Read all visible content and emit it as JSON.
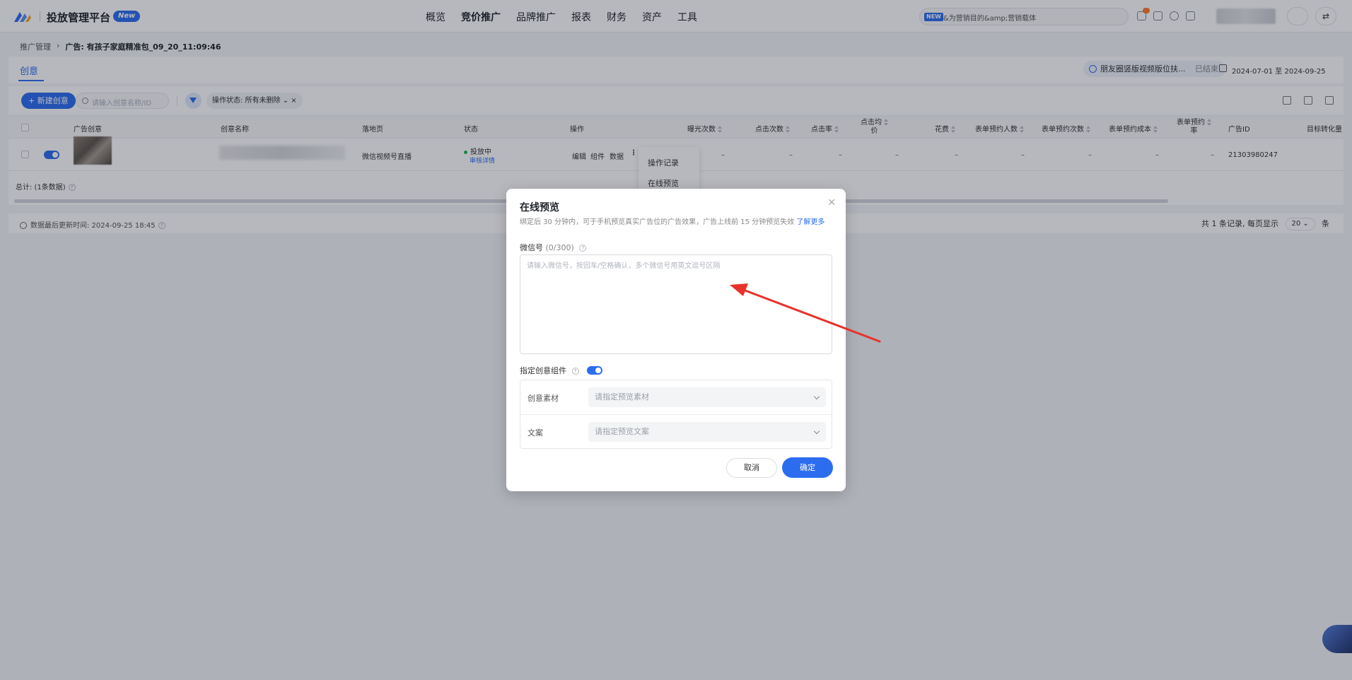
{
  "header": {
    "app_title": "投放管理平台",
    "new_badge": "New",
    "menu": [
      "概览",
      "竞价推广",
      "品牌推广",
      "报表",
      "财务",
      "资产",
      "工具"
    ],
    "active_menu": "竞价推广",
    "search_badge": "NEW",
    "search_text": "&为营销目的&amp;营销载体"
  },
  "breadcrumb": {
    "root": "推广管理",
    "current": "广告: 有孩子家庭精准包_09_20_11:09:46"
  },
  "tabs": {
    "active": "创意",
    "adgroup_name": "朋友圈竖版视频版位扶...",
    "adgroup_status": "已结束",
    "date_range": "2024-07-01 至 2024-09-25"
  },
  "toolbar": {
    "new_button": "+ 新建创意",
    "search_placeholder": "请输入创意名称/ID",
    "filter_tag": "操作状态: 所有未删除"
  },
  "table": {
    "headers": {
      "creative": "广告创意",
      "name": "创意名称",
      "landing": "落地页",
      "status": "状态",
      "ops": "操作",
      "impressions": "曝光次数",
      "clicks": "点击次数",
      "ctr": "点击率",
      "cpc_line1": "点击均",
      "cpc_line2": "价",
      "cost": "花费",
      "form_people": "表单预约人数",
      "form_count": "表单预约次数",
      "form_cost": "表单预约成本",
      "form_rate_line1": "表单预约",
      "form_rate_line2": "率",
      "ad_id": "广告ID",
      "conv": "目标转化量"
    },
    "row": {
      "landing": "微信视频号直播",
      "status": "投放中",
      "status_link": "审核详情",
      "op_edit": "编辑",
      "op_component": "组件",
      "op_data": "数据",
      "dash": "–",
      "ad_id": "21303980247"
    },
    "total": "总计: (1条数据)"
  },
  "op_menu": [
    "操作记录",
    "在线预览"
  ],
  "footer": {
    "update_time": "数据最后更新时间: 2024-09-25 18:45",
    "pagination_pre": "共 1 条记录, 每页显示",
    "page_size": "20",
    "pagination_post": "条"
  },
  "modal": {
    "title": "在线预览",
    "subtitle": "绑定后 30 分钟内，可于手机预览真实广告位的广告效果，广告上线前 15 分钟预览失效",
    "learn_more": "了解更多",
    "wechat_label": "微信号",
    "wechat_count": "(0/300)",
    "wechat_placeholder": "请输入微信号，按回车/空格确认，多个微信号用英文逗号区隔",
    "component_label": "指定创意组件",
    "material_label": "创意素材",
    "material_placeholder": "请指定预览素材",
    "copy_label": "文案",
    "copy_placeholder": "请指定预览文案",
    "cancel": "取消",
    "confirm": "确定"
  },
  "colors": {
    "primary": "#2c6df0",
    "annotation_arrow": "#e8322b",
    "status_green": "#21b35a"
  }
}
